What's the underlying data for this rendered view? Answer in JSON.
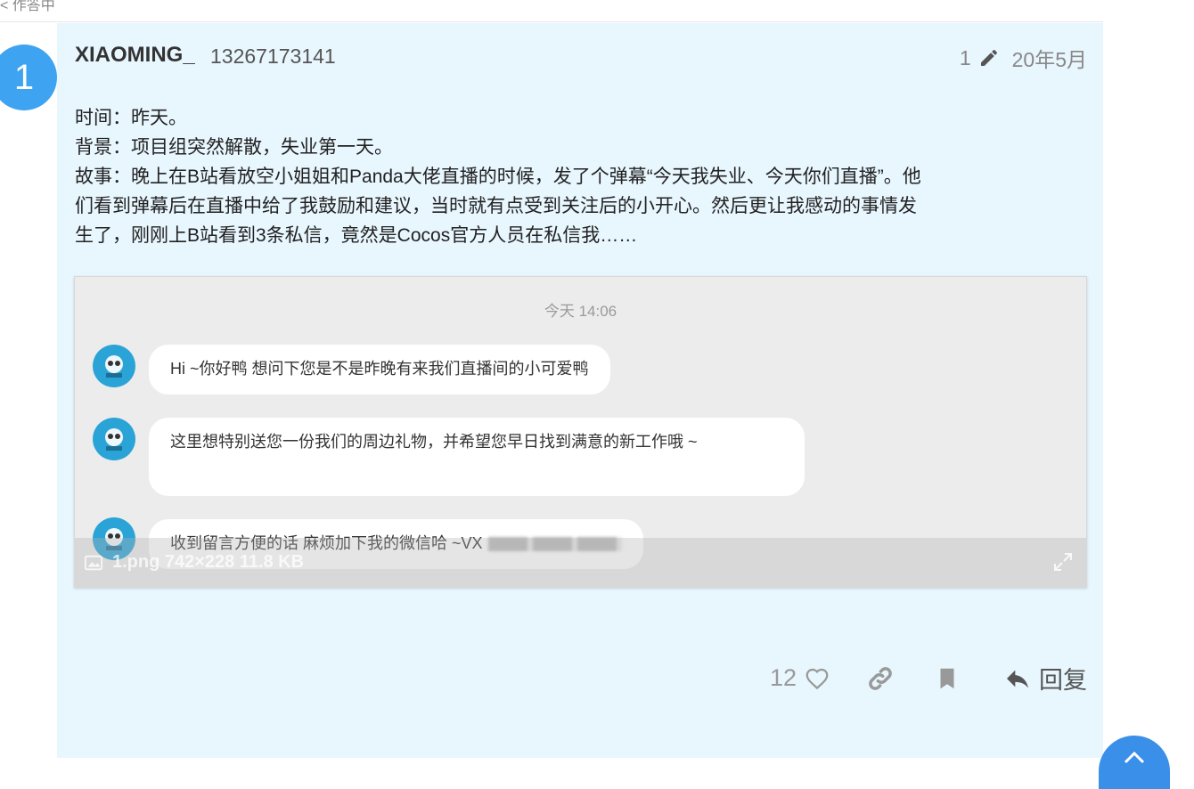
{
  "breadcrumb": "< 作答中",
  "post": {
    "number": "1",
    "username": "XIAOMING_",
    "phone": "13267173141",
    "edit_count": "1",
    "date": "20年5月",
    "body_lines": [
      "时间：昨天。",
      "背景：项目组突然解散，失业第一天。",
      "故事：晚上在B站看放空小姐姐和Panda大佬直播的时候，发了个弹幕“今天我失业、今天你们直播”。他",
      "们看到弹幕后在直播中给了我鼓励和建议，当时就有点受到关注后的小开心。然后更让我感动的事情发",
      "生了，刚刚上B站看到3条私信，竟然是Cocos官方人员在私信我……"
    ]
  },
  "image": {
    "timestamp": "今天 14:06",
    "messages": [
      {
        "text": "Hi ~你好鸭 想问下您是不是昨晚有来我们直播间的小可爱鸭"
      },
      {
        "text": "这里想特别送您一份我们的周边礼物，并希望您早日找到满意的新工作哦 ~"
      },
      {
        "text": "收到留言方便的话 麻烦加下我的微信哈 ~VX"
      }
    ],
    "caption": "1.png   742×228 11.8 KB"
  },
  "actions": {
    "like_count": "12",
    "reply_label": "回复"
  },
  "colors": {
    "post_bg": "#e8f6fe",
    "avatar": "#3ea3f0",
    "cocos_avatar": "#2aa3d6"
  }
}
